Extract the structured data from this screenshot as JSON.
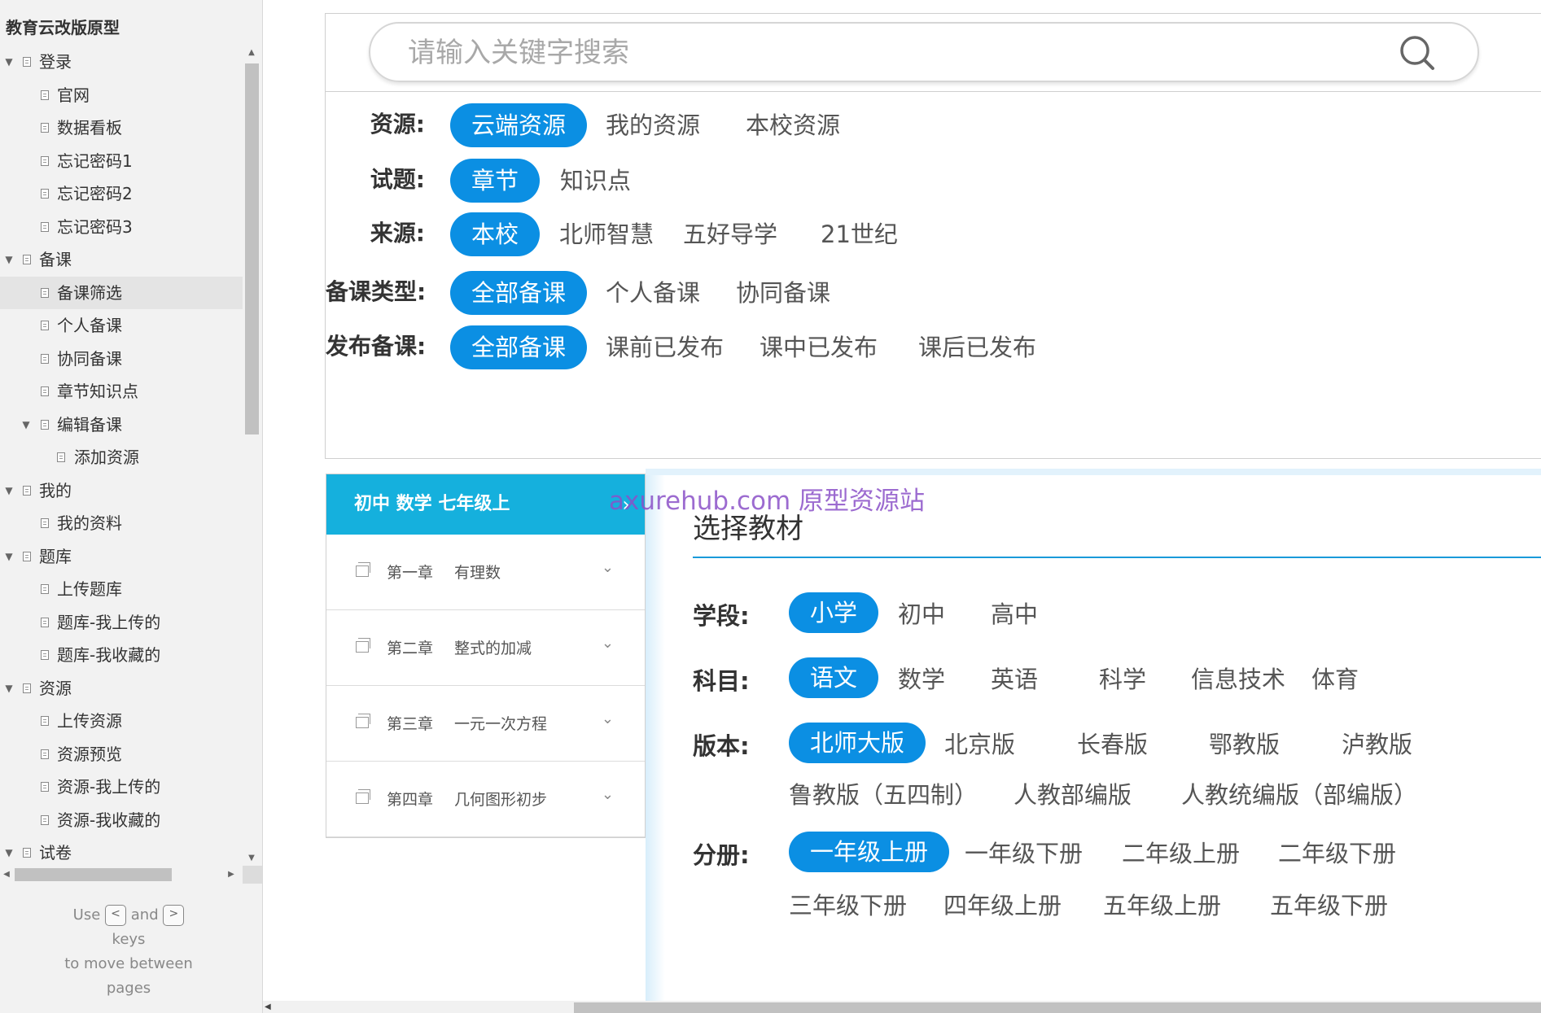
{
  "sidebar": {
    "title": "教育云改版原型",
    "items": [
      {
        "label": "登录",
        "level": 0,
        "expanded": true
      },
      {
        "label": "官网",
        "level": 1
      },
      {
        "label": "数据看板",
        "level": 1
      },
      {
        "label": "忘记密码1",
        "level": 1
      },
      {
        "label": "忘记密码2",
        "level": 1
      },
      {
        "label": "忘记密码3",
        "level": 1
      },
      {
        "label": "备课",
        "level": 0,
        "expanded": true
      },
      {
        "label": "备课筛选",
        "level": 1,
        "selected": true
      },
      {
        "label": "个人备课",
        "level": 1
      },
      {
        "label": "协同备课",
        "level": 1
      },
      {
        "label": "章节知识点",
        "level": 1
      },
      {
        "label": "编辑备课",
        "level": 1,
        "expanded": true
      },
      {
        "label": "添加资源",
        "level": 2
      },
      {
        "label": "我的",
        "level": 0,
        "expanded": true
      },
      {
        "label": "我的资料",
        "level": 1
      },
      {
        "label": "题库",
        "level": 0,
        "expanded": true
      },
      {
        "label": "上传题库",
        "level": 1
      },
      {
        "label": "题库-我上传的",
        "level": 1
      },
      {
        "label": "题库-我收藏的",
        "level": 1
      },
      {
        "label": "资源",
        "level": 0,
        "expanded": true
      },
      {
        "label": "上传资源",
        "level": 1
      },
      {
        "label": "资源预览",
        "level": 1
      },
      {
        "label": "资源-我上传的",
        "level": 1
      },
      {
        "label": "资源-我收藏的",
        "level": 1
      },
      {
        "label": "试卷",
        "level": 0,
        "expanded": true
      }
    ],
    "hint": {
      "use": "Use",
      "and": "and",
      "key_prev": "<",
      "key_next": ">",
      "keys": "keys",
      "line3": "to move between",
      "line4": "pages"
    }
  },
  "search": {
    "placeholder": "请输入关键字搜索",
    "value": ""
  },
  "filters": [
    {
      "label": "资源:",
      "options": [
        "云端资源",
        "我的资源",
        "本校资源"
      ],
      "active": 0
    },
    {
      "label": "试题:",
      "options": [
        "章节",
        "知识点"
      ],
      "active": 0
    },
    {
      "label": "来源:",
      "options": [
        "本校",
        "北师智慧",
        "五好导学",
        "21世纪"
      ],
      "active": 0
    },
    {
      "label": "备课类型:",
      "options": [
        "全部备课",
        "个人备课",
        "协同备课"
      ],
      "active": 0
    },
    {
      "label": "发布备课:",
      "options": [
        "全部备课",
        "课前已发布",
        "课中已发布",
        "课后已发布"
      ],
      "active": 0
    }
  ],
  "chapters": {
    "header": "初中 数学 七年级上",
    "header_icon": "chevron-right-icon",
    "items": [
      {
        "num": "第一章",
        "title": "有理数"
      },
      {
        "num": "第二章",
        "title": "整式的加减"
      },
      {
        "num": "第三章",
        "title": "一元一次方程"
      },
      {
        "num": "第四章",
        "title": "几何图形初步"
      }
    ]
  },
  "textbook": {
    "title": "选择教材",
    "rows": [
      {
        "label": "学段:",
        "options": [
          "小学",
          "初中",
          "高中"
        ],
        "active": 0
      },
      {
        "label": "科目:",
        "options": [
          "语文",
          "数学",
          "英语",
          "科学",
          "信息技术",
          "体育"
        ],
        "active": 0
      },
      {
        "label": "版本:",
        "options": [
          "北师大版",
          "北京版",
          "长春版",
          "鄂教版",
          "泸教版",
          "鲁教版（五四制）",
          "人教部编版",
          "人教统编版（部编版）"
        ],
        "active": 0
      },
      {
        "label": "分册:",
        "options": [
          "一年级上册",
          "一年级下册",
          "二年级上册",
          "二年级下册",
          "三年级下册",
          "四年级上册",
          "五年级上册",
          "五年级下册"
        ],
        "active": 0
      }
    ]
  },
  "watermark": "axurehub.com 原型资源站",
  "colors": {
    "accent": "#0b8fe3",
    "chapter_header": "#15b0dd",
    "watermark": "#8b52c8"
  }
}
